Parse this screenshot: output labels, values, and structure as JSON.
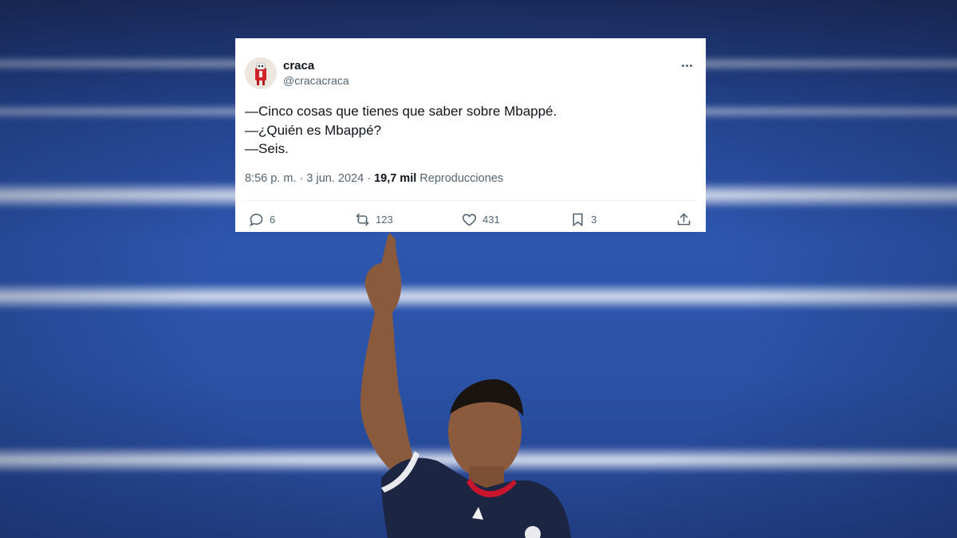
{
  "tweet": {
    "display_name": "craca",
    "handle": "@cracacraca",
    "lines": [
      "—Cinco cosas que tienes que saber sobre Mbappé.",
      "—¿Quién es Mbappé?",
      "—Seis."
    ],
    "time": "8:56 p. m.",
    "separator": "·",
    "date": "3 jun. 2024",
    "views_count": "19,7 mil",
    "views_label": "Reproducciones",
    "replies": "6",
    "reposts": "123",
    "likes": "431",
    "bookmarks": "3"
  },
  "icons": {
    "avatar": "avatar-icon",
    "more": "more-icon",
    "reply": "reply-icon",
    "repost": "repost-icon",
    "like": "heart-icon",
    "bookmark": "bookmark-icon",
    "share": "share-icon"
  },
  "colors": {
    "card_bg": "#ffffff",
    "text_primary": "#0f1419",
    "text_secondary": "#536471",
    "stadium_blue": "#2d56ae",
    "jersey_navy": "#1c2642"
  }
}
